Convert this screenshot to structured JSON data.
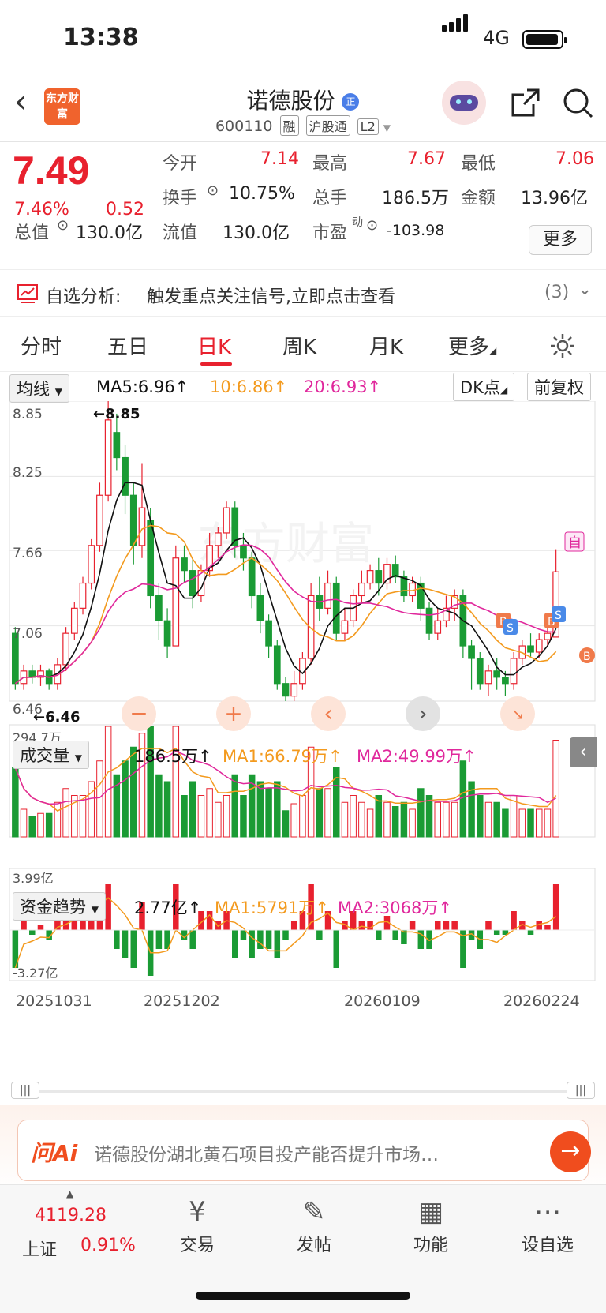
{
  "status": {
    "time": "13:38",
    "network": "4G"
  },
  "header": {
    "logo": "东方财富",
    "name": "诺德股份",
    "name_badge": "正",
    "code": "600110",
    "tags": [
      "融",
      "沪股通",
      "L2"
    ]
  },
  "quote": {
    "price": "7.49",
    "change_pct": "7.46%",
    "change": "0.52",
    "open_label": "今开",
    "open": "7.14",
    "high_label": "最高",
    "high": "7.67",
    "low_label": "最低",
    "low": "7.06",
    "turnover_label": "换手",
    "turnover": "10.75%",
    "volume_label": "总手",
    "volume": "186.5万",
    "amount_label": "金额",
    "amount": "13.96亿",
    "total_cap_label": "总值",
    "total_cap": "130.0亿",
    "float_cap_label": "流值",
    "float_cap": "130.0亿",
    "pe_label": "市盈",
    "pe_sup": "动",
    "pe": "-103.98",
    "more_label": "更多"
  },
  "analysis": {
    "title": "自选分析:",
    "text": "触发重点关注信号,立即点击查看",
    "count": "(3)"
  },
  "tabs": [
    "分时",
    "五日",
    "日K",
    "周K",
    "月K",
    "更多"
  ],
  "active_tab": "日K",
  "ma_bar": {
    "selector": "均线",
    "ma5": "MA5:6.96↑",
    "ma10": "10:6.86↑",
    "ma20": "20:6.93↑",
    "dk": "DK点",
    "adjust": "前复权"
  },
  "kline": {
    "ticks": [
      "8.85",
      "8.25",
      "7.66",
      "7.06",
      "6.46"
    ],
    "max_label": "←8.85",
    "min_label": "←6.46",
    "watermark": "东方财富",
    "marker_self": "自",
    "marker_buy": "B",
    "marker_sell": "S"
  },
  "volume": {
    "selector": "成交量",
    "value": "186.5万↑",
    "ma1": "MA1:66.79万↑",
    "ma2": "MA2:49.99万↑",
    "max_label": "294.7万"
  },
  "fund": {
    "selector": "资金趋势",
    "value": "2.77亿↑",
    "ma1": "MA1:5791万↑",
    "ma2": "MA2:3068万↑",
    "max_label": "3.99亿",
    "min_label": "-3.27亿"
  },
  "dates": [
    "20251031",
    "20251202",
    "20260109",
    "20260224"
  ],
  "ai": {
    "logo": "问Ai",
    "placeholder": "诺德股份湖北黄石项目投产能否提升市场…"
  },
  "bottom": {
    "index_value": "4119.28",
    "index_name": "上证",
    "index_pct": "0.91%",
    "items": [
      "交易",
      "发帖",
      "功能",
      "设自选"
    ]
  },
  "chart_data": {
    "type": "candlestick",
    "title": "",
    "ylim": [
      6.46,
      8.85
    ],
    "x_labels": [
      "20251031",
      "20251202",
      "20260109",
      "20260224"
    ],
    "candles": [
      [
        7.0,
        6.6,
        7.05,
        6.55
      ],
      [
        6.6,
        6.7,
        6.75,
        6.55
      ],
      [
        6.7,
        6.65,
        6.75,
        6.6
      ],
      [
        6.65,
        6.7,
        6.75,
        6.58
      ],
      [
        6.7,
        6.6,
        6.72,
        6.55
      ],
      [
        6.6,
        6.75,
        6.8,
        6.55
      ],
      [
        6.75,
        7.0,
        7.05,
        6.7
      ],
      [
        7.0,
        7.2,
        7.25,
        6.95
      ],
      [
        7.2,
        7.4,
        7.45,
        7.15
      ],
      [
        7.4,
        7.7,
        7.75,
        7.35
      ],
      [
        7.7,
        8.1,
        8.2,
        7.65
      ],
      [
        8.1,
        8.7,
        8.85,
        8.05
      ],
      [
        8.6,
        8.4,
        8.75,
        8.3
      ],
      [
        8.4,
        8.1,
        8.5,
        7.95
      ],
      [
        8.1,
        7.7,
        8.2,
        7.55
      ],
      [
        7.7,
        8.0,
        8.35,
        7.6
      ],
      [
        7.9,
        7.3,
        8.0,
        7.2
      ],
      [
        7.3,
        7.1,
        7.4,
        6.95
      ],
      [
        7.1,
        6.9,
        7.2,
        6.8
      ],
      [
        6.9,
        7.6,
        7.7,
        6.9
      ],
      [
        7.6,
        7.5,
        7.7,
        7.4
      ],
      [
        7.5,
        7.3,
        7.6,
        7.2
      ],
      [
        7.3,
        7.5,
        7.55,
        7.25
      ],
      [
        7.5,
        7.7,
        7.8,
        7.45
      ],
      [
        7.7,
        7.8,
        7.85,
        7.6
      ],
      [
        7.8,
        8.0,
        8.05,
        7.75
      ],
      [
        8.0,
        7.7,
        8.05,
        7.6
      ],
      [
        7.7,
        7.6,
        7.8,
        7.5
      ],
      [
        7.6,
        7.3,
        7.65,
        7.2
      ],
      [
        7.3,
        7.1,
        7.4,
        7.0
      ],
      [
        7.1,
        6.9,
        7.15,
        6.8
      ],
      [
        6.9,
        6.6,
        6.95,
        6.55
      ],
      [
        6.6,
        6.5,
        6.65,
        6.46
      ],
      [
        6.5,
        6.6,
        6.7,
        6.46
      ],
      [
        6.6,
        6.8,
        6.85,
        6.55
      ],
      [
        6.8,
        7.3,
        7.4,
        6.75
      ],
      [
        7.3,
        7.2,
        7.45,
        7.1
      ],
      [
        7.2,
        7.4,
        7.5,
        7.15
      ],
      [
        7.4,
        7.0,
        7.45,
        6.95
      ],
      [
        7.0,
        7.1,
        7.2,
        6.95
      ],
      [
        7.1,
        7.3,
        7.35,
        7.05
      ],
      [
        7.3,
        7.4,
        7.5,
        7.25
      ],
      [
        7.4,
        7.5,
        7.55,
        7.35
      ],
      [
        7.5,
        7.4,
        7.6,
        7.3
      ],
      [
        7.4,
        7.55,
        7.6,
        7.35
      ],
      [
        7.55,
        7.45,
        7.62,
        7.4
      ],
      [
        7.45,
        7.3,
        7.5,
        7.25
      ],
      [
        7.3,
        7.4,
        7.45,
        7.25
      ],
      [
        7.4,
        7.2,
        7.45,
        7.1
      ],
      [
        7.2,
        7.0,
        7.25,
        6.95
      ],
      [
        7.0,
        7.1,
        7.2,
        6.95
      ],
      [
        7.1,
        7.2,
        7.3,
        7.05
      ],
      [
        7.2,
        7.3,
        7.35,
        7.1
      ],
      [
        7.3,
        6.9,
        7.35,
        6.8
      ],
      [
        6.9,
        6.8,
        6.95,
        6.55
      ],
      [
        6.8,
        6.6,
        6.85,
        6.55
      ],
      [
        6.6,
        6.7,
        6.75,
        6.5
      ],
      [
        6.7,
        6.65,
        6.8,
        6.55
      ],
      [
        6.65,
        6.6,
        6.7,
        6.5
      ],
      [
        6.6,
        6.8,
        6.85,
        6.55
      ],
      [
        6.8,
        6.9,
        6.95,
        6.75
      ],
      [
        6.9,
        6.85,
        7.0,
        6.8
      ],
      [
        6.85,
        6.95,
        7.0,
        6.8
      ],
      [
        6.95,
        7.0,
        7.1,
        6.9
      ],
      [
        6.97,
        7.49,
        7.67,
        6.97
      ]
    ]
  }
}
